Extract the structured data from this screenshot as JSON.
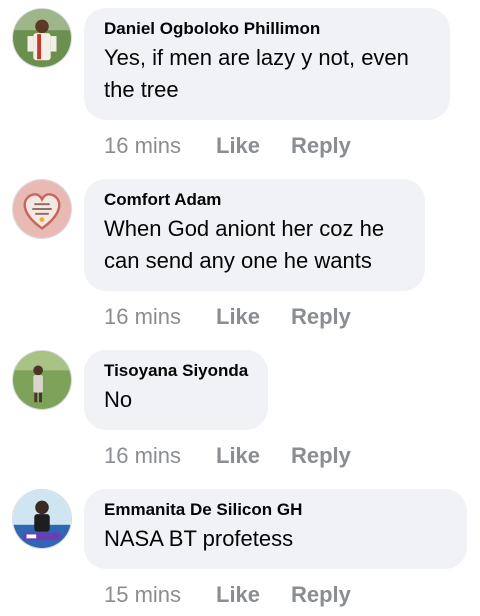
{
  "comments": [
    {
      "author": "Daniel Ogboloko Phillimon",
      "text": "Yes, if men are lazy y not, even the tree",
      "time": "16 mins",
      "like_label": "Like",
      "reply_label": "Reply"
    },
    {
      "author": "Comfort Adam",
      "text": "When God aniont her coz he can send any one he wants",
      "time": "16 mins",
      "like_label": "Like",
      "reply_label": "Reply"
    },
    {
      "author": "Tisoyana Siyonda",
      "text": "No",
      "time": "16 mins",
      "like_label": "Like",
      "reply_label": "Reply"
    },
    {
      "author": "Emmanita De Silicon GH",
      "text": "NASA BT profetess",
      "time": "15 mins",
      "like_label": "Like",
      "reply_label": "Reply"
    }
  ],
  "colors": {
    "bubble_bg": "#f0f2f5",
    "text": "#050505",
    "meta": "#8a8d91"
  }
}
